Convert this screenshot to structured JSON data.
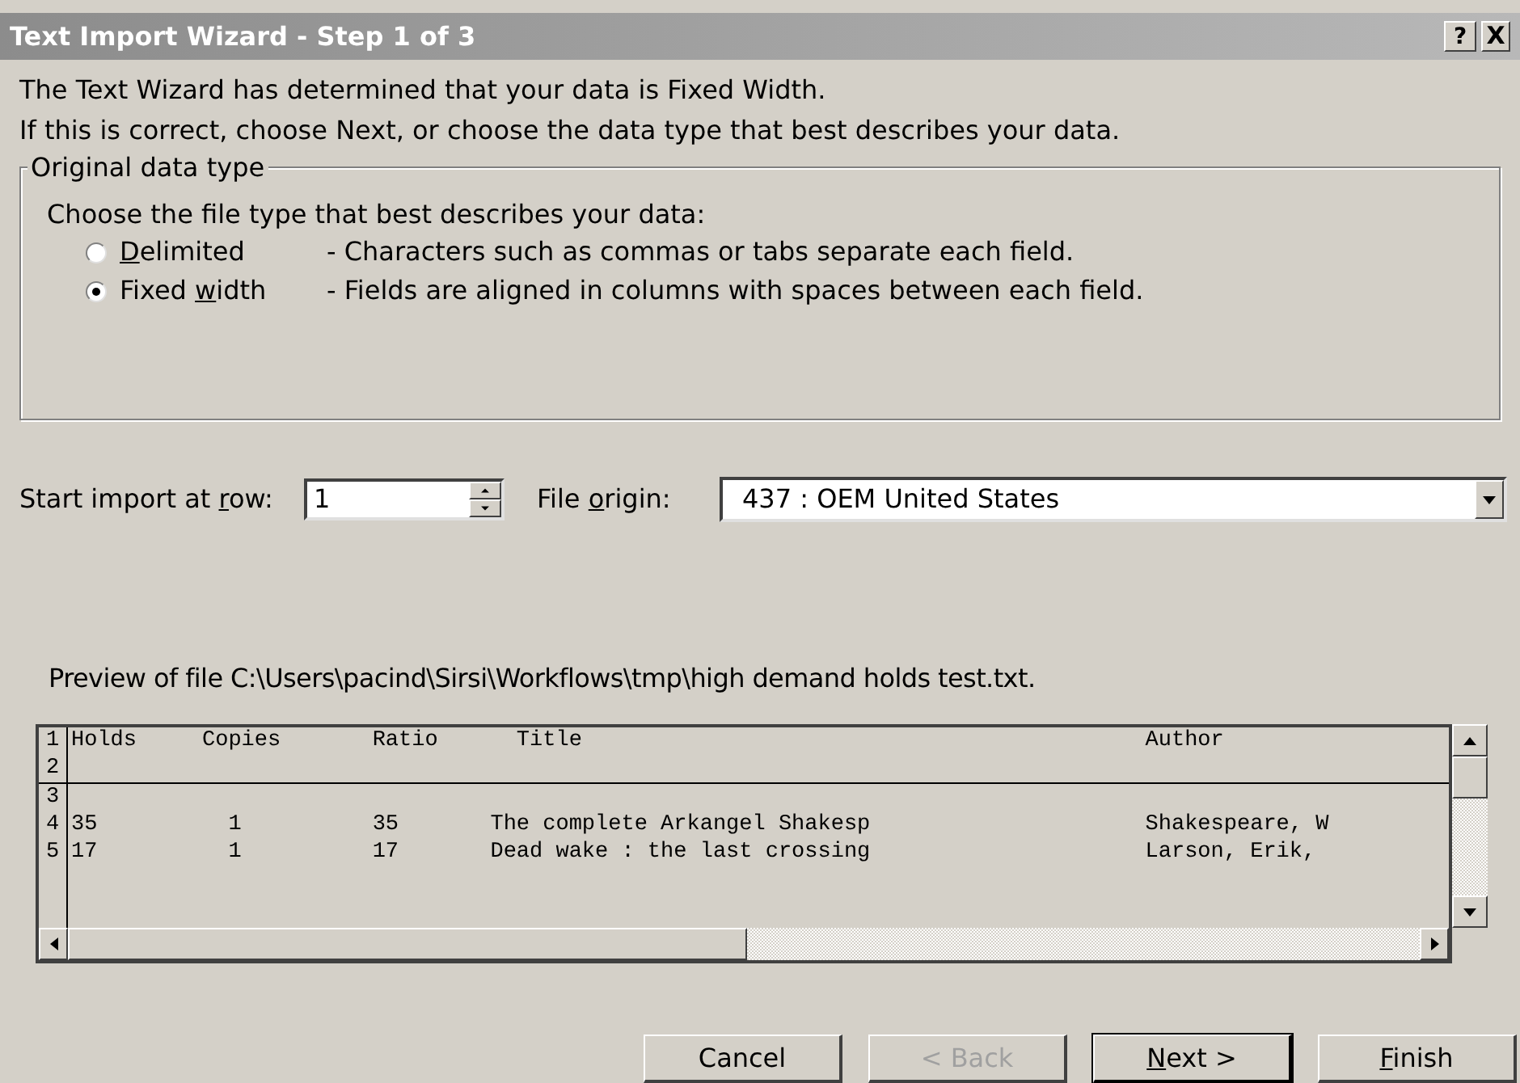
{
  "window": {
    "title": "Text Import Wizard - Step 1 of 3",
    "controls": [
      {
        "kind": "help",
        "label": "?"
      },
      {
        "kind": "close",
        "label": "X"
      }
    ]
  },
  "intro": [
    "The Text Wizard has determined that your data is Fixed Width.",
    "If this is correct, choose Next, or choose the data type that best describes your data."
  ],
  "data_type": {
    "legend": "Original data type",
    "prompt": "Choose the file type that best describes your data:",
    "options": [
      {
        "label": {
          "key": "D",
          "after": "elimited"
        },
        "description": "- Characters such as commas or tabs separate each field.",
        "selected": false
      },
      {
        "label": {
          "before": "Fixed ",
          "key": "w",
          "after": "idth"
        },
        "description": "- Fields are aligned in columns with spaces between each field.",
        "selected": true
      }
    ]
  },
  "start_row": {
    "label": {
      "before": "Start import at ",
      "key": "r",
      "after": "ow:"
    },
    "value": "1"
  },
  "file_origin": {
    "label": {
      "before": "File ",
      "key": "o",
      "after": "rigin:"
    },
    "value": "437 : OEM United States"
  },
  "preview": {
    "caption": "Preview of file C:\\Users\\pacind\\Sirsi\\Workflows\\tmp\\high demand holds test.txt.",
    "rows": [
      {
        "number": "1",
        "kind": "header",
        "cells": [
          "Holds",
          "Copies",
          "Ratio",
          "Title",
          "Author"
        ]
      },
      {
        "number": "2",
        "kind": "blank"
      },
      {
        "number": "3",
        "kind": "blank"
      },
      {
        "number": "4",
        "kind": "data",
        "cells": [
          "35",
          "1",
          "35",
          "The complete Arkangel Shakesp",
          "Shakespeare, W"
        ]
      },
      {
        "number": "5",
        "kind": "data",
        "cells": [
          "17",
          "1",
          "17",
          "Dead wake : the last crossing",
          "Larson, Erik,"
        ]
      }
    ]
  },
  "buttons": [
    {
      "label": {
        "before": "Cancel"
      },
      "disabled": false,
      "default": false
    },
    {
      "label": {
        "before": "< Back"
      },
      "disabled": true,
      "default": false
    },
    {
      "label": {
        "key": "N",
        "after": "ext >"
      },
      "disabled": false,
      "default": true
    },
    {
      "label": {
        "key": "F",
        "after": "inish"
      },
      "disabled": false,
      "default": false
    }
  ]
}
